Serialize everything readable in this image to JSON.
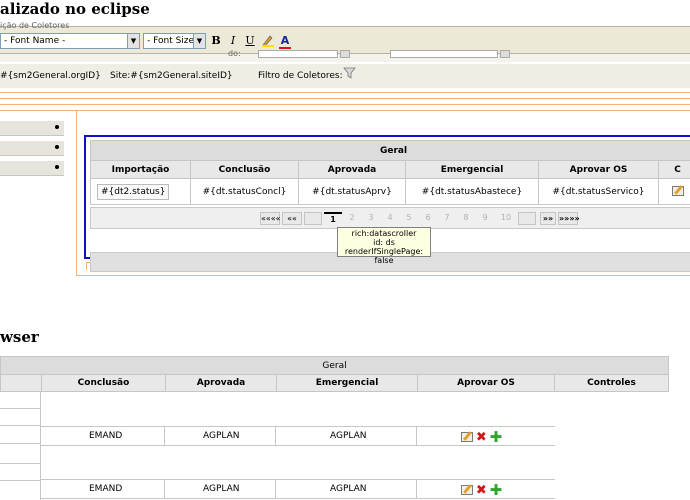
{
  "section1_title": "alizado no eclipse",
  "section2_title": "wser",
  "toolbar": {
    "font_name": "- Font Name -",
    "font_size": "- Font Size -",
    "bold": "B",
    "italic": "I",
    "underline": "U",
    "highlight_icon": "highlight-icon",
    "font_color_icon": "font-color-icon",
    "font_color_label": "A"
  },
  "partial_label": "ição de Coletores",
  "partial_label2": "do:",
  "info_bar": {
    "org": "#{sm2General.orgID}",
    "site": "Site:#{sm2General.siteID}",
    "filter": "Filtro de Coletores:",
    "filter_icon": "filter-icon"
  },
  "design_table": {
    "group_header": "Geral",
    "columns": [
      "Importação",
      "Conclusão",
      "Aprovada",
      "Emergencial",
      "Aprovar OS",
      "C"
    ],
    "row": [
      "#{dt2.status}",
      "#{dt.statusConcl}",
      "#{dt.statusAprv}",
      "#{dt.statusAbastece}",
      "#{dt.statusServico}"
    ]
  },
  "pager": {
    "first": "««««",
    "prev": "««",
    "pages": [
      "1",
      "2",
      "3",
      "4",
      "5",
      "6",
      "7",
      "8",
      "9",
      "10"
    ],
    "next": "»»",
    "last": "»»»»"
  },
  "tooltip": {
    "line1": "rich:datascroller",
    "line2": "id: ds",
    "line3": "renderIfSinglePage: false"
  },
  "browser_table": {
    "group_header": "Geral",
    "columns": [
      "Conclusão",
      "Aprovada",
      "Emergencial",
      "Aprovar OS",
      "Controles"
    ],
    "rows": [
      {
        "conclusao": "EMAND",
        "aprovada": "AGPLAN",
        "emergencial": "AGPLAN"
      },
      {
        "conclusao": "EMAND",
        "aprovada": "AGPLAN",
        "emergencial": "AGPLAN"
      }
    ]
  },
  "colors": {
    "accent_border": "#1010c8",
    "orange_guides": "#f3b07a",
    "delete_red": "#d21616",
    "add_green": "#2ca72c"
  }
}
